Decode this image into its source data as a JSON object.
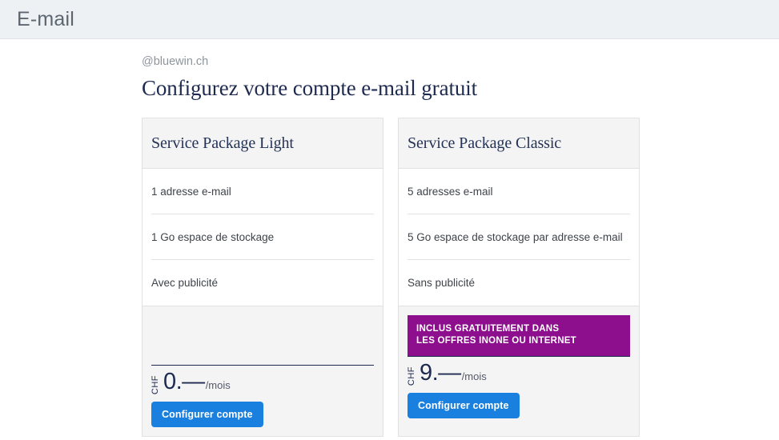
{
  "appbar": {
    "title": "E-mail"
  },
  "page": {
    "domain_label": "@bluewin.ch",
    "title": "Configurez votre compte e-mail gratuit"
  },
  "colors": {
    "appbar_background": "#eef1f4",
    "accent_blue": "#1980e0",
    "promo_purple": "#8d0f8d",
    "heading_navy": "#1e2a50",
    "card_header_gray": "#f4f4f4"
  },
  "cards": [
    {
      "title": "Service Package Light",
      "features": [
        "1 adresse e-mail",
        "1 Go espace de stockage",
        "Avec publicité"
      ],
      "promo": null,
      "price": {
        "currency": "CHF",
        "amount": "0.—",
        "period": "/mois"
      },
      "cta_label": "Configurer compte"
    },
    {
      "title": "Service Package Classic",
      "features": [
        "5 adresses e-mail",
        "5 Go espace de stockage par adresse e-mail",
        "Sans publicité"
      ],
      "promo": {
        "line1": "INCLUS GRATUITEMENT DANS",
        "line2": "LES OFFRES INONE OU INTERNET"
      },
      "price": {
        "currency": "CHF",
        "amount": "9.—",
        "period": "/mois"
      },
      "cta_label": "Configurer compte"
    }
  ]
}
